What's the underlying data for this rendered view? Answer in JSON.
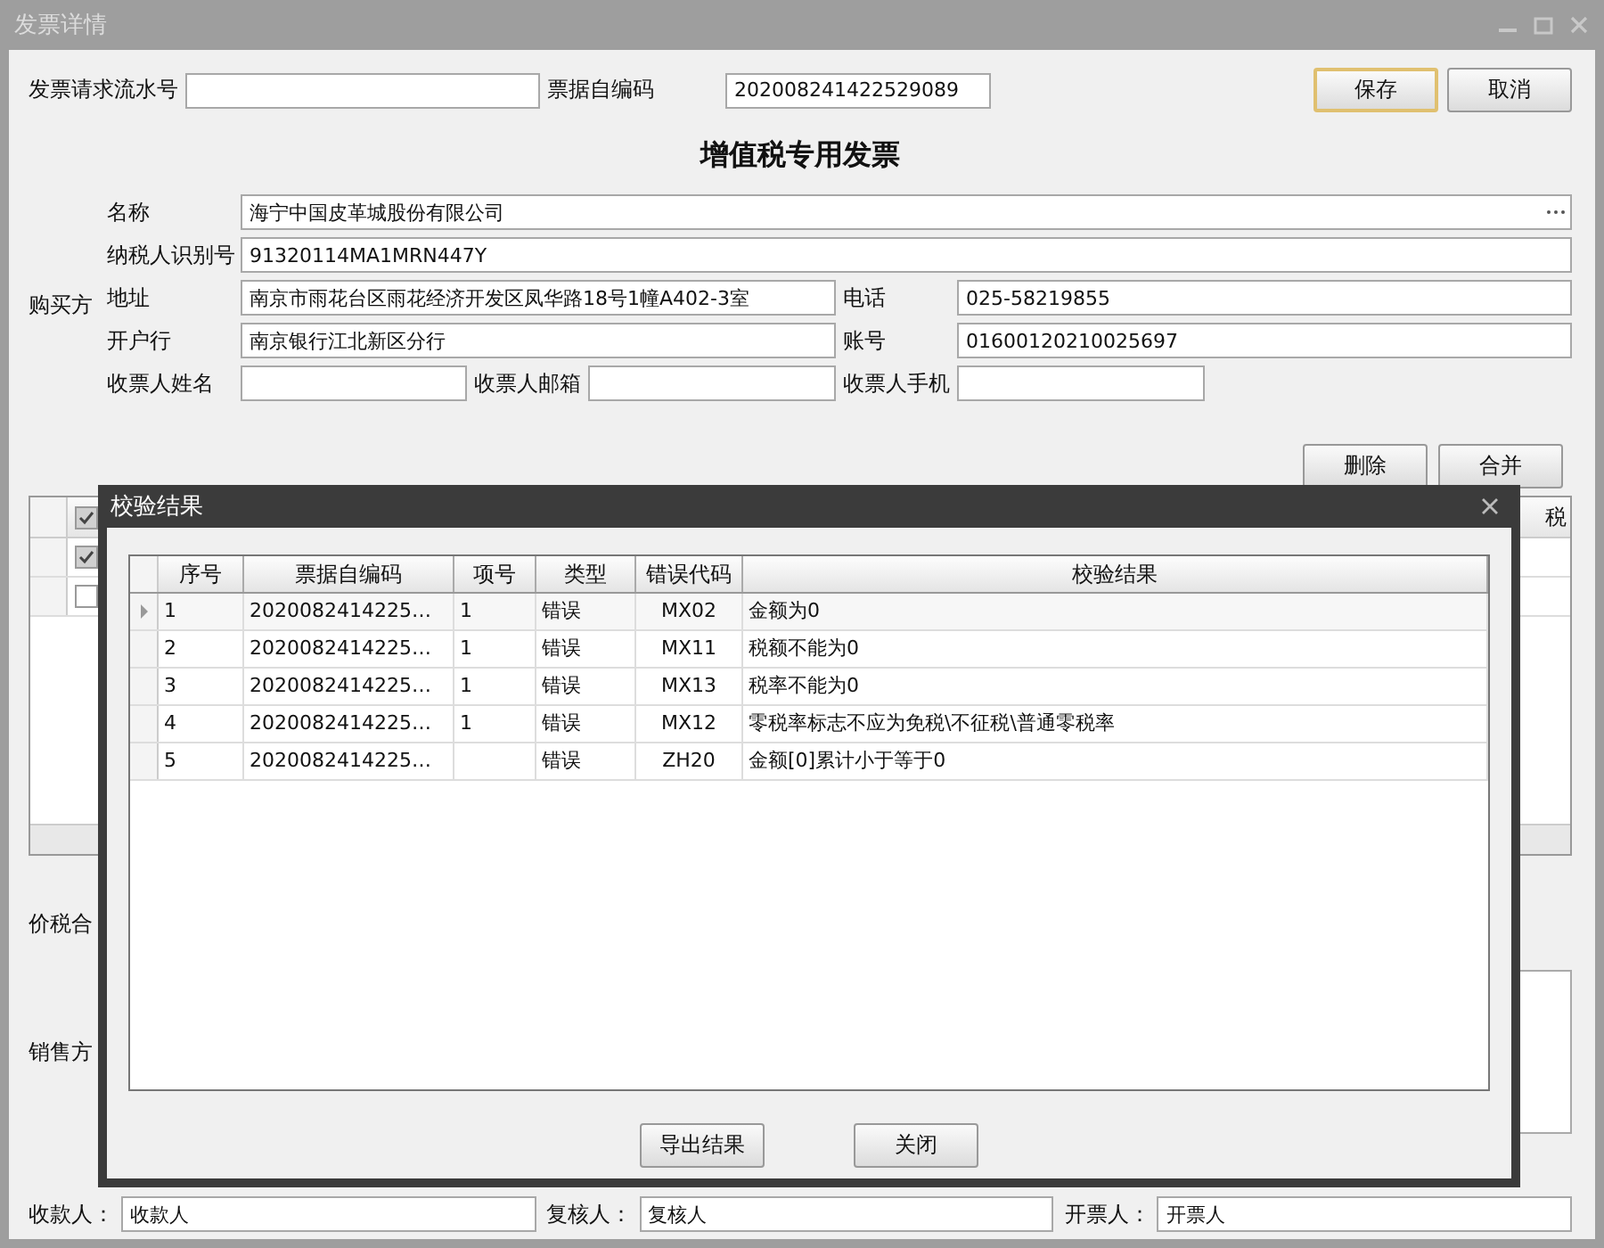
{
  "window": {
    "title": "发票详情"
  },
  "header": {
    "serial_label": "发票请求流水号",
    "code_label": "票据自编码",
    "code_value": "202008241422529089",
    "buttons": [
      {
        "label": "保存",
        "focused": true
      },
      {
        "label": "取消",
        "focused": false
      }
    ]
  },
  "invoice_title": "增值税专用发票",
  "buyer": {
    "section_label": "购买方",
    "name": {
      "label": "名称",
      "value": "海宁中国皮革城股份有限公司"
    },
    "tax_id": {
      "label": "纳税人识别号",
      "value": "91320114MA1MRN447Y"
    },
    "address": {
      "label": "地址",
      "value": "南京市雨花台区雨花经济开发区凤华路18号1幢A402-3室"
    },
    "phone": {
      "label": "电话",
      "value": "025-58219855"
    },
    "bank": {
      "label": "开户行",
      "value": "南京银行江北新区分行"
    },
    "account": {
      "label": "账号",
      "value": "01600120210025697"
    },
    "receiver_name": {
      "label": "收票人姓名"
    },
    "receiver_email": {
      "label": "收票人邮箱"
    },
    "receiver_phone": {
      "label": "收票人手机"
    }
  },
  "item_buttons": [
    "删除",
    "合并"
  ],
  "items_table": {
    "header_checked": true,
    "column_last": "税",
    "rows": [
      {
        "checked": true
      },
      {
        "checked": false
      }
    ]
  },
  "total_label": "价税合",
  "seller_label": "销售方",
  "signers": [
    {
      "label": "收款人：",
      "value": "收款人"
    },
    {
      "label": "复核人：",
      "value": "复核人"
    },
    {
      "label": "开票人：",
      "value": "开票人"
    }
  ],
  "dialog": {
    "title": "校验结果",
    "columns": [
      "序号",
      "票据自编码",
      "项号",
      "类型",
      "错误代码",
      "校验结果"
    ],
    "rows": [
      {
        "selected": true,
        "cells": [
          "1",
          "2020082414225…",
          "1",
          "错误",
          "MX02",
          "金额为0"
        ]
      },
      {
        "selected": false,
        "cells": [
          "2",
          "2020082414225…",
          "1",
          "错误",
          "MX11",
          "税额不能为0"
        ]
      },
      {
        "selected": false,
        "cells": [
          "3",
          "2020082414225…",
          "1",
          "错误",
          "MX13",
          "税率不能为0"
        ]
      },
      {
        "selected": false,
        "cells": [
          "4",
          "2020082414225…",
          "1",
          "错误",
          "MX12",
          "零税率标志不应为免税\\不征税\\普通零税率"
        ]
      },
      {
        "selected": false,
        "cells": [
          "5",
          "2020082414225…",
          "",
          "错误",
          "ZH20",
          "金额[0]累计小于等于0"
        ]
      }
    ],
    "buttons": [
      "导出结果",
      "关闭"
    ]
  }
}
